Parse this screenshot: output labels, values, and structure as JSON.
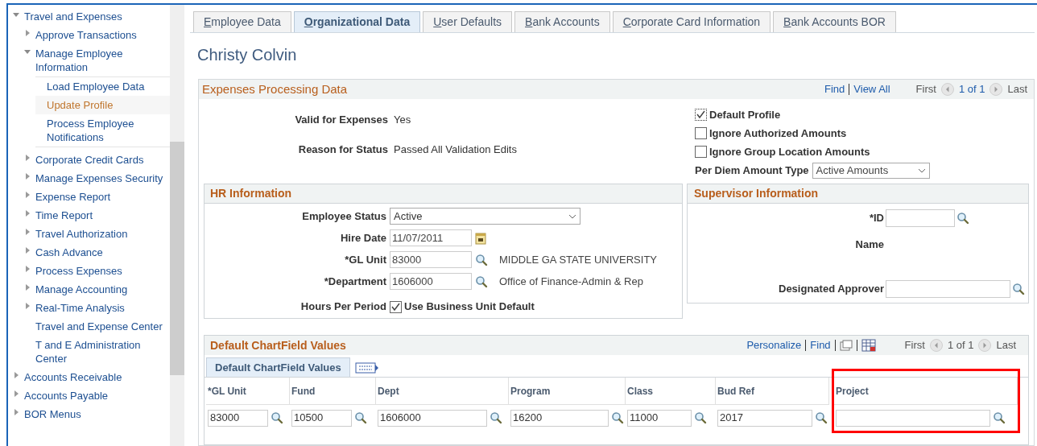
{
  "sidebar": {
    "items": [
      {
        "label": "Travel and Expenses",
        "kind": "folder",
        "expanded": true,
        "selected": false,
        "children": [
          {
            "label": "Approve Transactions",
            "kind": "folder",
            "expanded": false,
            "selected": false
          },
          {
            "label": "Manage Employee Information",
            "kind": "folder",
            "expanded": true,
            "selected": false,
            "children": [
              {
                "label": "Load Employee Data",
                "selected": false
              },
              {
                "label": "Update Profile",
                "selected": true
              },
              {
                "label": "Process Employee Notifications",
                "selected": false
              }
            ]
          },
          {
            "label": "Corporate Credit Cards",
            "kind": "folder",
            "expanded": false,
            "selected": false
          },
          {
            "label": "Manage Expenses Security",
            "kind": "folder",
            "expanded": false,
            "selected": false
          },
          {
            "label": "Expense Report",
            "kind": "folder",
            "expanded": false,
            "selected": false
          },
          {
            "label": "Time Report",
            "kind": "folder",
            "expanded": false,
            "selected": false
          },
          {
            "label": "Travel Authorization",
            "kind": "folder",
            "expanded": false,
            "selected": false
          },
          {
            "label": "Cash Advance",
            "kind": "folder",
            "expanded": false,
            "selected": false
          },
          {
            "label": "Process Expenses",
            "kind": "folder",
            "expanded": false,
            "selected": false
          },
          {
            "label": "Manage Accounting",
            "kind": "folder",
            "expanded": false,
            "selected": false
          },
          {
            "label": "Real-Time Analysis",
            "kind": "folder",
            "expanded": false,
            "selected": false
          },
          {
            "label": "Travel and Expense Center",
            "kind": "link",
            "selected": false
          },
          {
            "label": "T and E Administration Center",
            "kind": "link",
            "selected": false
          }
        ]
      },
      {
        "label": "Accounts Receivable",
        "kind": "folder",
        "expanded": false,
        "selected": false
      },
      {
        "label": "Accounts Payable",
        "kind": "folder",
        "expanded": false,
        "selected": false
      },
      {
        "label": "BOR Menus",
        "kind": "folder",
        "expanded": false,
        "selected": false
      }
    ]
  },
  "tabs": [
    {
      "label": "Employee Data",
      "selected": false
    },
    {
      "label": "Organizational Data",
      "selected": true
    },
    {
      "label": "User Defaults",
      "selected": false
    },
    {
      "label": "Bank Accounts",
      "selected": false
    },
    {
      "label": "Corporate Card Information",
      "selected": false
    },
    {
      "label": "Bank Accounts BOR",
      "selected": false
    }
  ],
  "employee_name": "Christy Colvin",
  "expenses_processing": {
    "title": "Expenses Processing Data",
    "find": "Find",
    "view_all": "View All",
    "first": "First",
    "count": "1 of 1",
    "last": "Last",
    "info": [
      {
        "label": "Valid for Expenses",
        "value": "Yes"
      },
      {
        "label": "Reason for Status",
        "value": "Passed All Validation Edits"
      }
    ],
    "checkboxes": [
      {
        "label": "Default Profile",
        "checked": true
      },
      {
        "label": "Ignore Authorized Amounts",
        "checked": false
      },
      {
        "label": "Ignore Group Location Amounts",
        "checked": false
      }
    ],
    "per_diem": {
      "label": "Per Diem Amount Type",
      "value": "Active Amounts"
    }
  },
  "hr_information": {
    "title": "HR Information",
    "fields": [
      {
        "kind": "select",
        "label": "Employee Status",
        "value": "Active"
      },
      {
        "kind": "date",
        "label": "Hire Date",
        "value": "11/07/2011"
      },
      {
        "kind": "lookup",
        "label": "*GL Unit",
        "value": "83000",
        "description": "MIDDLE GA STATE UNIVERSITY"
      },
      {
        "kind": "lookup",
        "label": "*Department",
        "value": "1606000",
        "description": "Office of Finance-Admin & Rep"
      },
      {
        "kind": "checkbox",
        "label": "Hours Per Period",
        "option": "Use Business Unit Default",
        "checked": true
      }
    ]
  },
  "supervisor_information": {
    "title": "Supervisor Information",
    "id_label": "*ID",
    "name_label": "Name",
    "approver_label": "Designated Approver"
  },
  "chartfield": {
    "title": "Default ChartField Values",
    "personalize": "Personalize",
    "find": "Find",
    "first": "First",
    "count": "1 of 1",
    "last": "Last",
    "tab": "Default ChartField Values",
    "columns": [
      {
        "label": "*GL Unit",
        "value": "83000",
        "highlighted": false
      },
      {
        "label": "Fund",
        "value": "10500",
        "highlighted": false
      },
      {
        "label": "Dept",
        "value": "1606000",
        "highlighted": false
      },
      {
        "label": "Program",
        "value": "16200",
        "highlighted": false
      },
      {
        "label": "Class",
        "value": "11000",
        "highlighted": false
      },
      {
        "label": "Bud Ref",
        "value": "2017",
        "highlighted": false
      },
      {
        "label": "Project",
        "highlighted": true
      }
    ]
  }
}
